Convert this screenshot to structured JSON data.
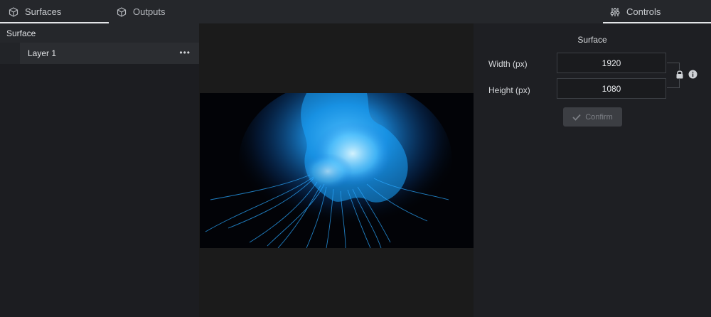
{
  "tabs": {
    "surfaces": "Surfaces",
    "outputs": "Outputs",
    "controls": "Controls"
  },
  "tree": {
    "root": "Surface",
    "child": "Layer 1",
    "more": "•••"
  },
  "controls": {
    "title": "Surface",
    "width_label": "Width (px)",
    "width_value": "1920",
    "height_label": "Height (px)",
    "height_value": "1080",
    "confirm_label": "Confirm"
  },
  "icons": {
    "surfaces_tab": "cube-icon",
    "outputs_tab": "cube-icon",
    "controls_tab": "sliders-icon",
    "lock": "lock-icon",
    "info": "info-icon",
    "more": "more-icon",
    "confirm": "checkmark-icon"
  },
  "colors": {
    "accent_underline": "#e3e5e8",
    "preview_glow": "#1ea0ff"
  }
}
